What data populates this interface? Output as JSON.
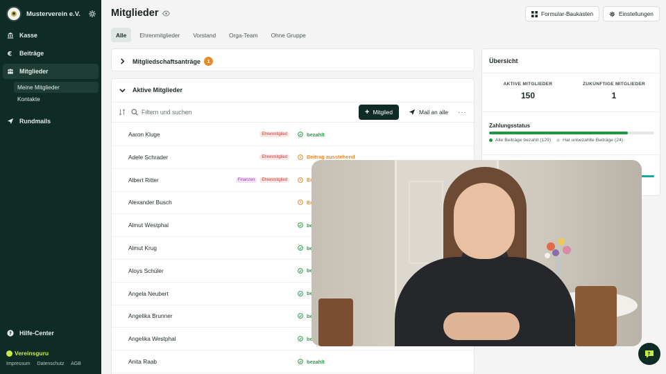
{
  "sidebar": {
    "org_name": "Musterverein e.V.",
    "nav": [
      {
        "label": "Kasse",
        "icon": "bank-icon"
      },
      {
        "label": "Beiträge",
        "icon": "euro-icon"
      },
      {
        "label": "Mitglieder",
        "icon": "members-icon",
        "active": true
      },
      {
        "label": "Rundmails",
        "icon": "paper-plane-icon"
      }
    ],
    "sub_items": [
      "Meine Mitglieder",
      "Kontakte"
    ],
    "help": "Hilfe-Center",
    "brand": "Vereinsguru",
    "footer_links": [
      "Impressum",
      "Datenschutz",
      "AGB"
    ]
  },
  "header": {
    "title": "Mitglieder",
    "form_builder": "Formular-Baukasten",
    "settings": "Einstellungen"
  },
  "tabs": [
    "Alle",
    "Ehrenmitglieder",
    "Vorstand",
    "Orga-Team",
    "Ohne Gruppe"
  ],
  "applications": {
    "label": "Mitgliedschaftsanträge",
    "count": "1"
  },
  "active_members": {
    "label": "Aktive Mitglieder",
    "search_placeholder": "Filtern und suchen",
    "add_button": "Mitglied",
    "mail_button": "Mail an alle",
    "rows": [
      {
        "name": "Aaron Kluge",
        "badges": [
          "Ehrenmitglied"
        ],
        "status": "bezahlt",
        "status_type": "paid"
      },
      {
        "name": "Adele Schrader",
        "badges": [
          "Ehrenmitglied"
        ],
        "status": "Beitrag ausstehend",
        "status_type": "pending"
      },
      {
        "name": "Albert Ritter",
        "badges": [
          "Finanzen",
          "Ehrenmitglied"
        ],
        "status": "Er",
        "status_type": "pending"
      },
      {
        "name": "Alexander Busch",
        "badges": [],
        "status": "Er",
        "status_type": "pending"
      },
      {
        "name": "Almut Westphal",
        "badges": [],
        "status": "be",
        "status_type": "paid"
      },
      {
        "name": "Almut Krug",
        "badges": [],
        "status": "be",
        "status_type": "paid"
      },
      {
        "name": "Aloys Schüler",
        "badges": [],
        "status": "be",
        "status_type": "paid"
      },
      {
        "name": "Angela Neubert",
        "badges": [],
        "status": "be",
        "status_type": "paid"
      },
      {
        "name": "Angelika Brunner",
        "badges": [],
        "status": "be",
        "status_type": "paid"
      },
      {
        "name": "Angelika Westphal",
        "badges": [],
        "status": "be",
        "status_type": "paid"
      },
      {
        "name": "Anita Raab",
        "badges": [],
        "status": "bezahlt",
        "status_type": "paid"
      }
    ]
  },
  "overview": {
    "title": "Übersicht",
    "active_label": "AKTIVE MITGLIEDER",
    "active_value": "150",
    "future_label": "ZUKÜNFTIGE MITGLIEDER",
    "future_value": "1",
    "payment_label": "Zahlungsstatus",
    "paid_fraction": 0.84,
    "legend_paid": "Alle Beiträge bezahlt (129)",
    "legend_unpaid": "Hat unbezahlte Beiträge (24)"
  },
  "colors": {
    "sidebar": "#0f2b25",
    "paid": "#27a046",
    "pending": "#e8892a",
    "honor_badge": "#c6372c",
    "finance_badge": "#9b3cb6"
  }
}
